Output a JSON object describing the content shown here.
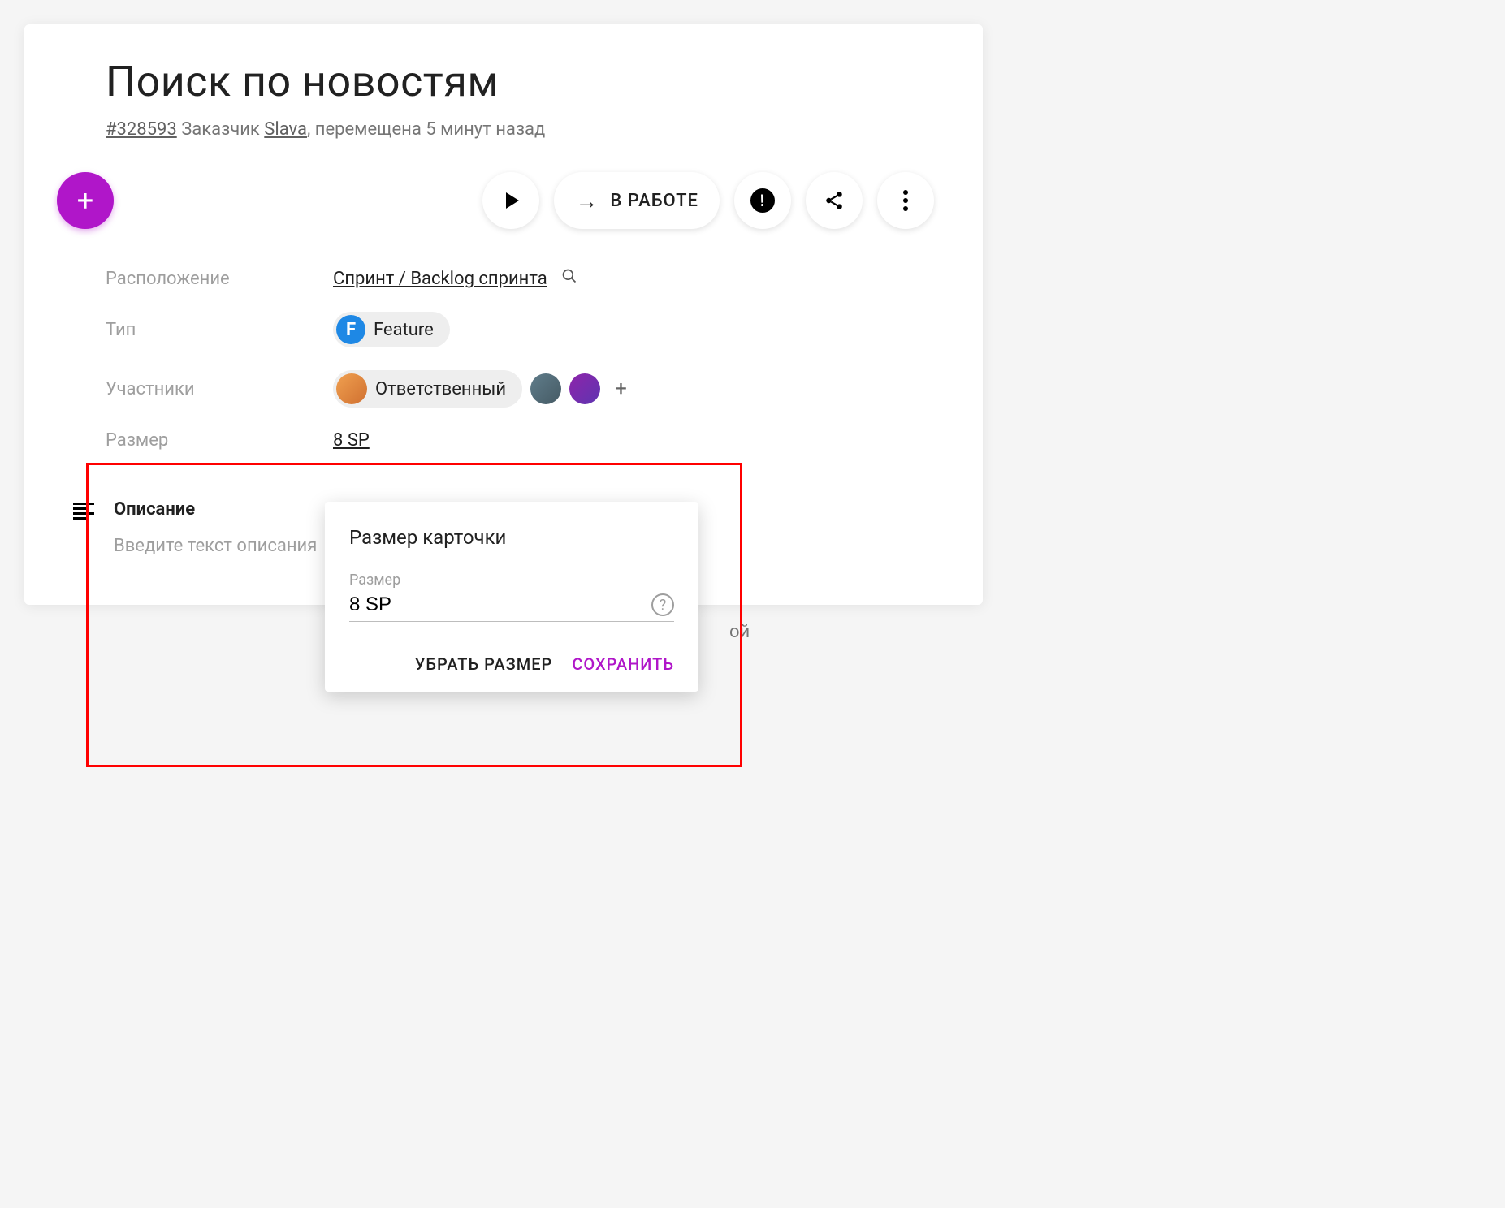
{
  "title": "Поиск по новостям",
  "meta": {
    "id": "#328593",
    "customer_label": "Заказчик",
    "customer_name": "Slava",
    "suffix": ", перемещена 5 минут назад"
  },
  "toolbar": {
    "in_work_label": "В РАБОТЕ"
  },
  "props": {
    "location_label": "Расположение",
    "location_value": "Спринт / Backlog спринта",
    "type_label": "Тип",
    "type_badge": "F",
    "type_value": "Feature",
    "people_label": "Участники",
    "responsible_label": "Ответственный",
    "size_label": "Размер",
    "size_value": "8 SP"
  },
  "description": {
    "heading": "Описание",
    "placeholder": "Введите текст описания"
  },
  "truncated_suffix": "ой",
  "popover": {
    "title": "Размер карточки",
    "field_label": "Размер",
    "field_value": "8 SP",
    "remove_label": "УБРАТЬ РАЗМЕР",
    "save_label": "СОХРАНИТЬ"
  }
}
